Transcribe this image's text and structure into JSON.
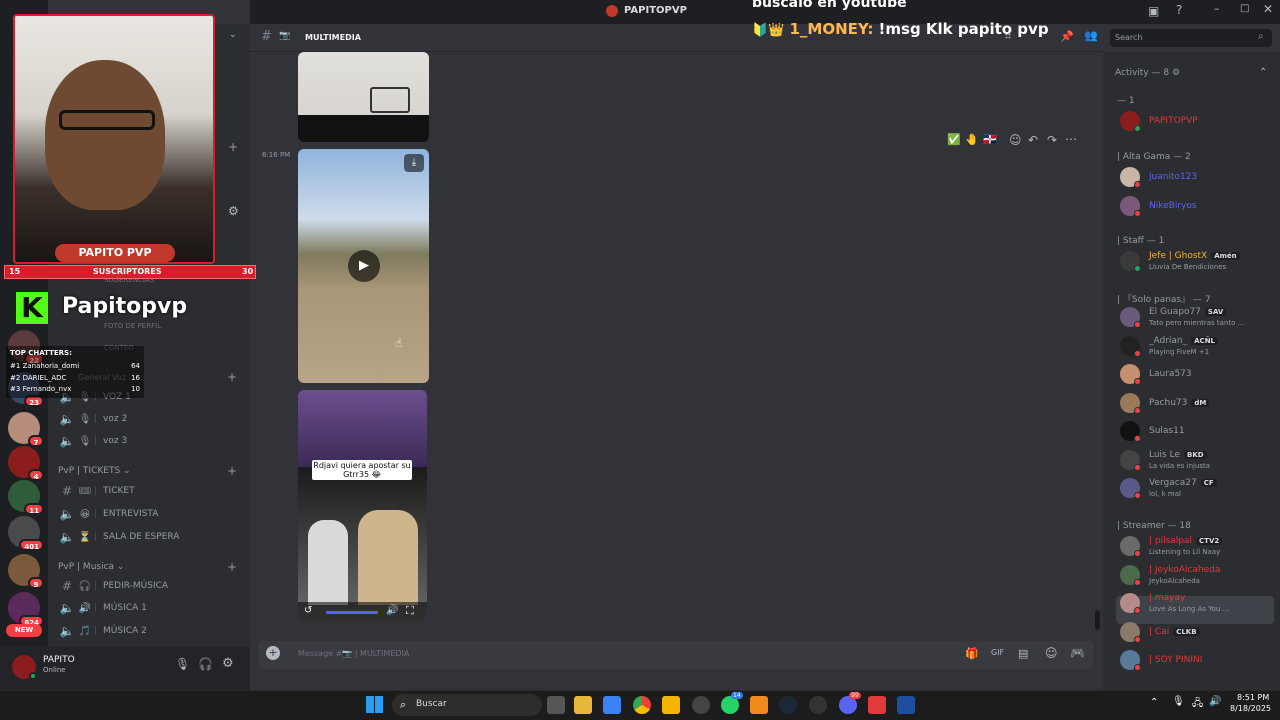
{
  "titlebar": {
    "server_name": "PAPITOPVP"
  },
  "channel": {
    "name": "MULTIMEDIA",
    "emoji": "📷"
  },
  "search": {
    "placeholder": "Search"
  },
  "stream_overlay": {
    "ticker": "buscalo en youtube",
    "chat_user": "1_MONEY:",
    "chat_msg": "!msg Klk papito pvp",
    "webcam_label": "PAPITO PVP",
    "subs_left": "15",
    "subs_label": "SUSCRIPTORES",
    "subs_right": "30",
    "kick_name": "Papitopvp",
    "top_chatters_title": "TOP CHATTERS:",
    "top_chatters": [
      {
        "rank": "#1",
        "name": "Zanahoria_domi",
        "count": "64"
      },
      {
        "rank": "#2",
        "name": "DARIEL_ADC",
        "count": "16"
      },
      {
        "rank": "#3",
        "name": "Fernando_nvx",
        "count": "10"
      }
    ]
  },
  "server_rail": {
    "badges": [
      "22",
      "23",
      "7",
      "4",
      "11",
      "401",
      "9",
      "624"
    ],
    "new_label": "NEW"
  },
  "sidebar": {
    "partial_items": [
      "SUGERENCIAS",
      "FOTO DE PERFIL",
      "CONTEO",
      "General Voz"
    ],
    "voice_channels": [
      {
        "name": "VOZ 1"
      },
      {
        "name": "voz 2"
      },
      {
        "name": "voz 3"
      }
    ],
    "categories": [
      {
        "title": "PvP | TICKETS",
        "channels": [
          {
            "icon": "hash",
            "emoji": "🎟",
            "name": "TICKET"
          },
          {
            "icon": "speaker",
            "emoji": "😀",
            "name": "ENTREVISTA"
          },
          {
            "icon": "speaker",
            "emoji": "⏳",
            "name": "SALA DE ESPERA"
          }
        ]
      },
      {
        "title": "PvP | Musica",
        "channels": [
          {
            "icon": "hash",
            "emoji": "🎧",
            "name": "PEDIR-MÚSICA"
          },
          {
            "icon": "speaker",
            "emoji": "🔊",
            "name": "MÚSICA 1"
          },
          {
            "icon": "speaker",
            "emoji": "🎵",
            "name": "MÚSICA 2"
          }
        ]
      }
    ]
  },
  "user_panel": {
    "name": "PAPITO",
    "status": "Online"
  },
  "messages": {
    "timestamp": "6:16 PM",
    "video_caption": "Rdjavi quiera apostar su Gtrr35 😂",
    "reactions": [
      "✅",
      "🤚",
      "🇩🇴"
    ]
  },
  "composer": {
    "placeholder": "Message #📷 | MULTIMEDIA"
  },
  "members": {
    "activity_label": "Activity — 8",
    "groups": [
      {
        "title": "— 1",
        "members": [
          {
            "name": "PAPITOPVP",
            "color": "#e03a3a",
            "sub": ""
          }
        ]
      },
      {
        "title": "| Alta Gama — 2",
        "members": [
          {
            "name": "juanito123",
            "color": "#5865f2",
            "sub": ""
          },
          {
            "name": "NikeBiryos",
            "color": "#5865f2",
            "sub": ""
          }
        ]
      },
      {
        "title": "| Staff — 1",
        "members": [
          {
            "name": "Jefe | GhostX",
            "color": "#f0b232",
            "tag": "Amén",
            "sub": "Lluvia De Bendiciones"
          }
        ]
      },
      {
        "title": "| 『Solo panas』 — 7",
        "members": [
          {
            "name": "El Guapo77",
            "color": "#949ba4",
            "tag": "SAV",
            "sub": "Tato pero mientras tanto ..."
          },
          {
            "name": "_Adrian_",
            "color": "#949ba4",
            "tag": "ACÑL",
            "sub": "Playing FiveM +1"
          },
          {
            "name": "Laura573",
            "color": "#949ba4",
            "sub": ""
          },
          {
            "name": "Pachu73",
            "color": "#949ba4",
            "tag": "dM",
            "sub": ""
          },
          {
            "name": "Sulas11",
            "color": "#949ba4",
            "sub": ""
          },
          {
            "name": "Luis Le",
            "color": "#949ba4",
            "tag": "BKD",
            "sub": "La vida es injusta"
          },
          {
            "name": "Vergaca27",
            "color": "#949ba4",
            "tag": "CF",
            "sub": "lol, k mal"
          }
        ]
      },
      {
        "title": "| Streamer — 18",
        "members": [
          {
            "name": "| pilsalpal",
            "color": "#e03a3a",
            "tag": "CTV2",
            "sub": "Listening to Lil Naay"
          },
          {
            "name": "| JeykoAlcaheda",
            "color": "#e03a3a",
            "sub": "JeykoAlcaheda"
          },
          {
            "name": "| mayay",
            "color": "#e03a3a",
            "sub": "Love As Long As You ..."
          },
          {
            "name": "| Cai",
            "color": "#e03a3a",
            "tag": "CLKB",
            "sub": ""
          },
          {
            "name": "| SOY PININI",
            "color": "#e03a3a",
            "sub": ""
          }
        ]
      }
    ]
  },
  "taskbar": {
    "search_placeholder": "Buscar",
    "time": "8:51 PM",
    "date": "8/18/2025",
    "whatsapp_badge": "14",
    "discord_badge": "99"
  },
  "colors": {
    "accent": "#d61f2a",
    "online": "#23a55a",
    "dnd": "#f23f43",
    "bg": "#313338"
  }
}
